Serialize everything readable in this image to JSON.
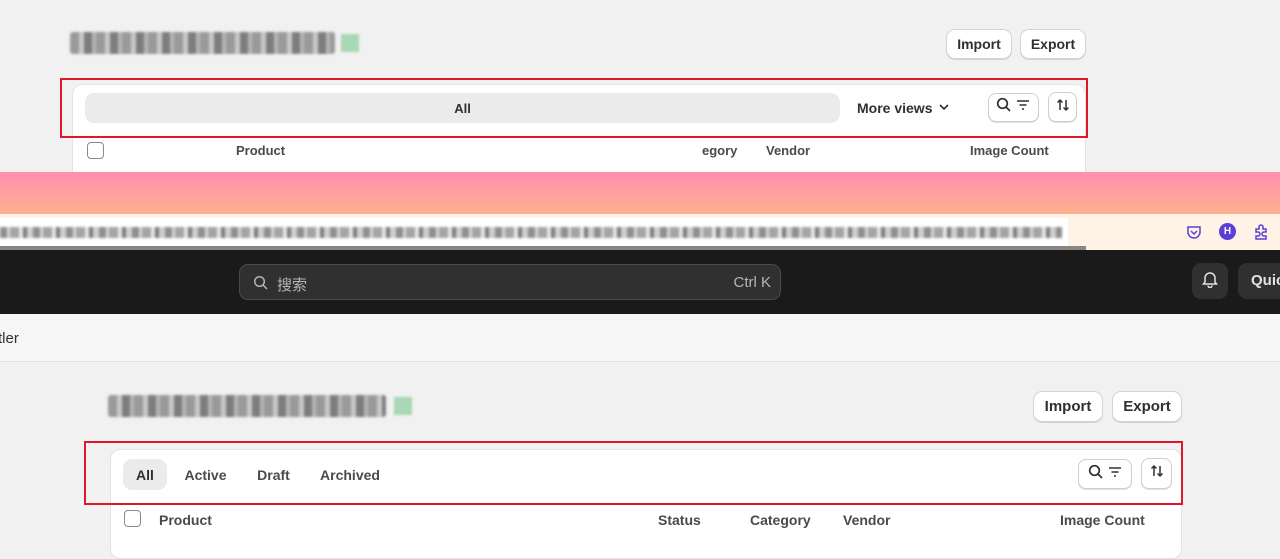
{
  "top_panel": {
    "title_blurred": "",
    "import_label": "Import",
    "export_label": "Export",
    "tab_all": "All",
    "more_views": "More views",
    "columns": [
      "Product",
      "egory",
      "Vendor",
      "Image Count"
    ]
  },
  "browser": {
    "url_blurred": "",
    "extension_avatar_letter": "H"
  },
  "admin_bar": {
    "search_placeholder": "搜索",
    "shortcut": "Ctrl K",
    "quick_label": "Quic"
  },
  "breadcrumb_fragment": "tler",
  "bottom_panel": {
    "import_label": "Import",
    "export_label": "Export",
    "tabs": [
      "All",
      "Active",
      "Draft",
      "Archived"
    ],
    "columns": [
      "Product",
      "Status",
      "Category",
      "Vendor",
      "Image Count"
    ]
  },
  "colors": {
    "highlight_border": "#e0162b",
    "gradient_top": "#ff8fb0",
    "gradient_bottom": "#ffb08e",
    "admin_bar_bg": "#1a1a1a",
    "avatar_purple": "#5b3fd6"
  }
}
